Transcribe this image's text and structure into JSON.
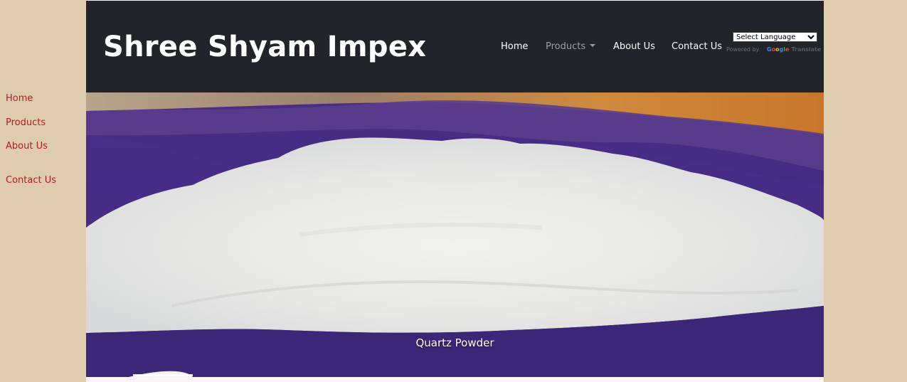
{
  "sidebar": {
    "items": [
      {
        "label": "Home"
      },
      {
        "label": "Products"
      },
      {
        "label": "About Us"
      },
      {
        "label": "Contact Us"
      }
    ]
  },
  "header": {
    "brand": "Shree Shyam Impex",
    "nav": [
      {
        "label": "Home"
      },
      {
        "label": "Products"
      },
      {
        "label": "About Us"
      },
      {
        "label": "Contact Us"
      }
    ],
    "translate": {
      "selected": "Select Language",
      "powered_by": "Powered by",
      "google": "Google",
      "translate_label": "Translate"
    }
  },
  "carousel": {
    "caption": "Quartz Powder"
  },
  "colors": {
    "page_bg": "#dfcbb0",
    "header_bg": "#212529",
    "side_link": "#b21d1d",
    "nav_muted": "#9a9da1"
  }
}
